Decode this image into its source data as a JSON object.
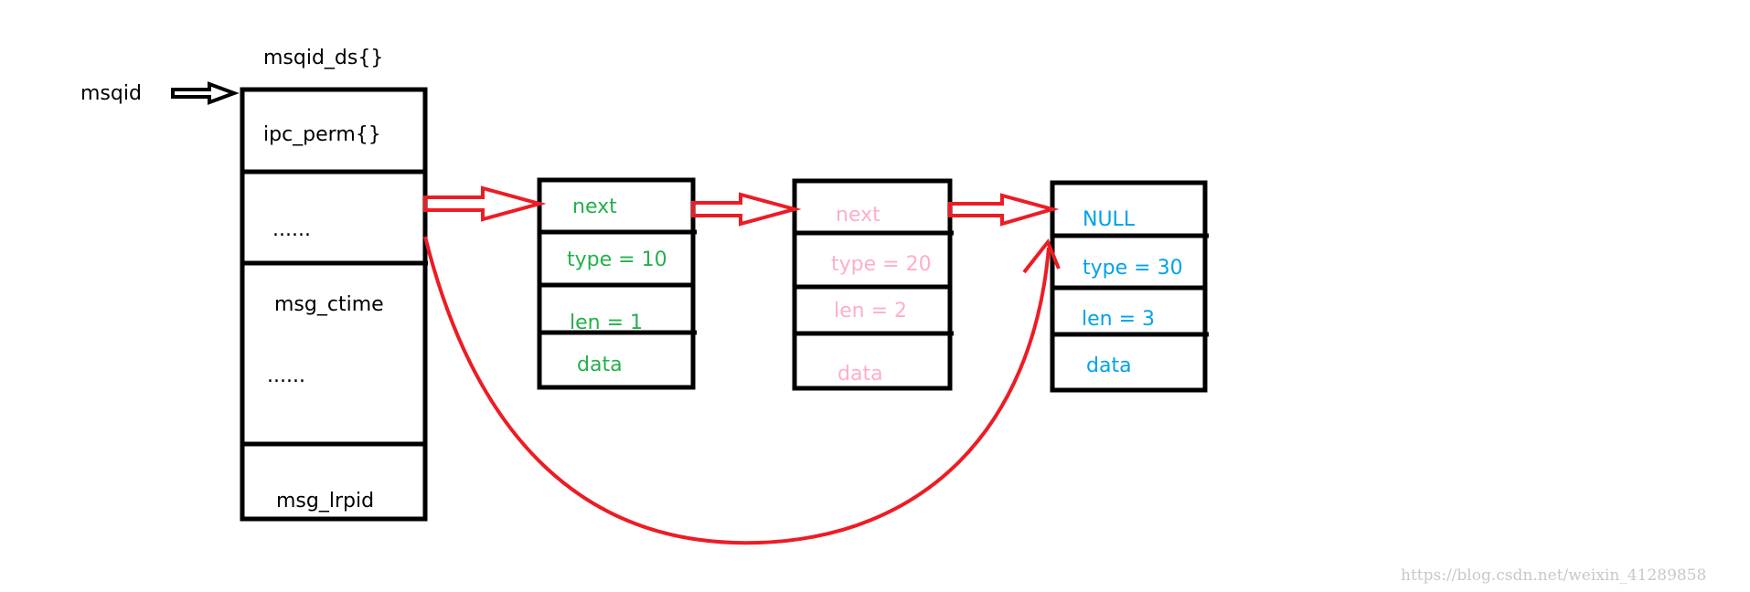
{
  "colors": {
    "black": "#000000",
    "red": "#ed1c24",
    "green": "#22b14c",
    "pink": "#ffaec9",
    "blue": "#00a2e8"
  },
  "pointer_label": "msqid",
  "struct": {
    "title": "msqid_ds{}",
    "fields": [
      "ipc_perm{}",
      "......",
      "msg_ctime",
      "......",
      "msg_lrpid"
    ]
  },
  "messages": [
    {
      "fields": [
        "next",
        "type = 10",
        "len = 1",
        "data"
      ],
      "color": "#22b14c"
    },
    {
      "fields": [
        "next",
        "type = 20",
        "len = 2",
        "data"
      ],
      "color": "#ffaec9"
    },
    {
      "fields": [
        "NULL",
        "type = 30",
        "len = 3",
        "data"
      ],
      "color": "#00a2e8"
    }
  ],
  "watermark": "https://blog.csdn.net/weixin_41289858"
}
